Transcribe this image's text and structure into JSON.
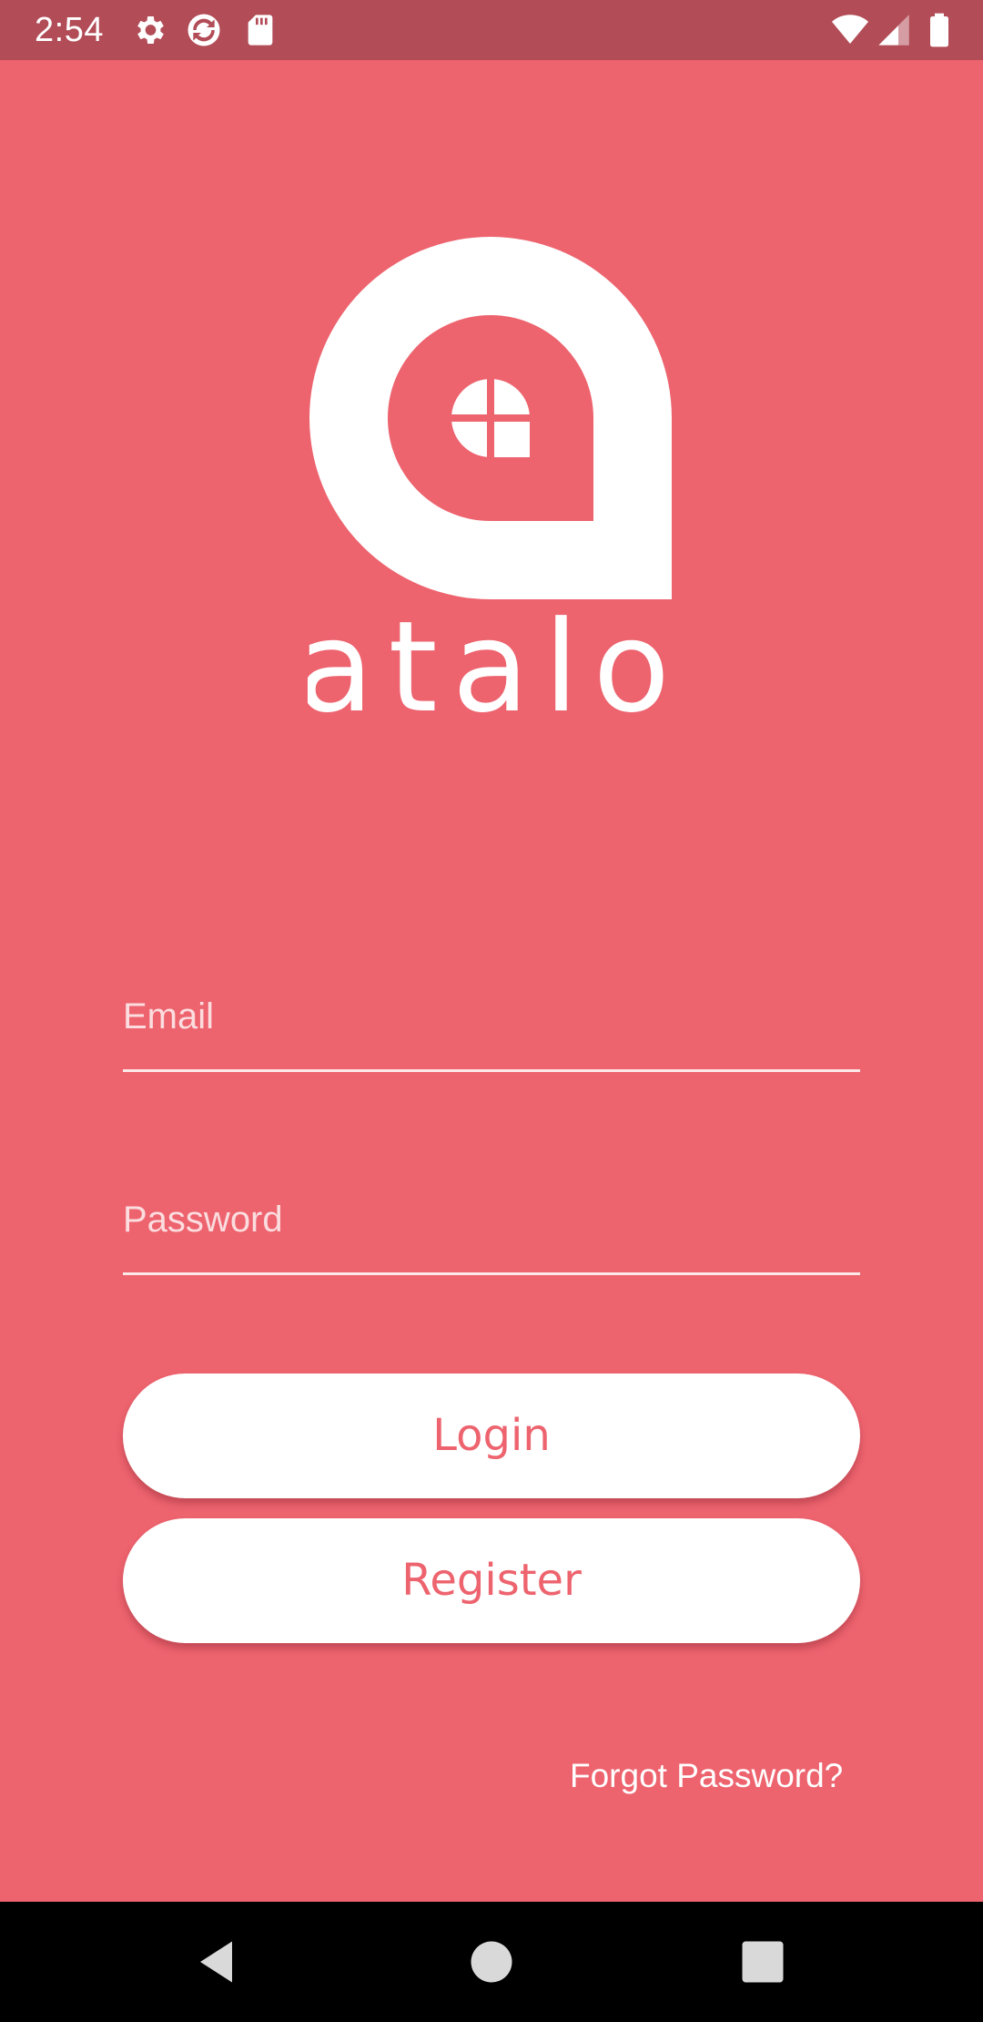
{
  "status_bar": {
    "time": "2:54",
    "icons": [
      "gear-icon",
      "sync-icon",
      "sd-card-icon",
      "wifi-icon",
      "signal-icon",
      "battery-icon"
    ],
    "background": "#b24c57"
  },
  "brand": {
    "name": "atalo",
    "background": "#ed636e",
    "logo_color": "#ffffff"
  },
  "form": {
    "email": {
      "value": "",
      "placeholder": "Email"
    },
    "password": {
      "value": "",
      "placeholder": "Password"
    },
    "login_label": "Login",
    "register_label": "Register",
    "forgot_label": "Forgot Password?"
  },
  "nav_bar": {
    "icons": [
      "back-icon",
      "home-icon",
      "recents-icon"
    ]
  }
}
